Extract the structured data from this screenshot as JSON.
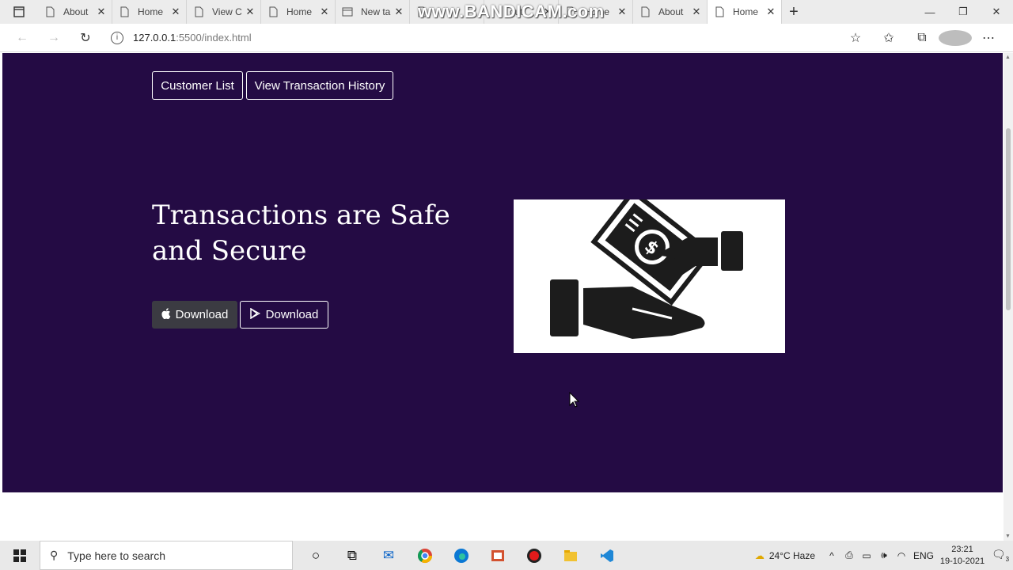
{
  "browser": {
    "tabs": [
      {
        "label": "About",
        "icon": "page-icon"
      },
      {
        "label": "Home",
        "icon": "page-icon"
      },
      {
        "label": "View C",
        "icon": "page-icon"
      },
      {
        "label": "Home",
        "icon": "page-icon"
      },
      {
        "label": "New ta",
        "icon": "newtab-icon"
      },
      {
        "label": "",
        "icon": "page-icon"
      },
      {
        "label": "out",
        "icon": "page-icon"
      },
      {
        "label": "Home",
        "icon": "page-icon"
      },
      {
        "label": "About",
        "icon": "page-icon"
      },
      {
        "label": "Home",
        "icon": "page-icon"
      }
    ],
    "watermark": "www.BANDICAM.com",
    "url": {
      "host": "127.0.0.1",
      "path": ":5500/index.html"
    }
  },
  "page": {
    "nav": {
      "customer_list": "Customer List",
      "history": "View Transaction History"
    },
    "hero": {
      "title": "Transactions are Safe and Secure",
      "download_apple": "Download",
      "download_play": "Download",
      "image_alt": "hand-money-icon"
    },
    "colors": {
      "hero_bg": "#240b44"
    }
  },
  "taskbar": {
    "search_placeholder": "Type here to search",
    "weather": "24°C  Haze",
    "lang": "ENG",
    "time": "23:21",
    "date": "19-10-2021",
    "notifications": "3"
  }
}
